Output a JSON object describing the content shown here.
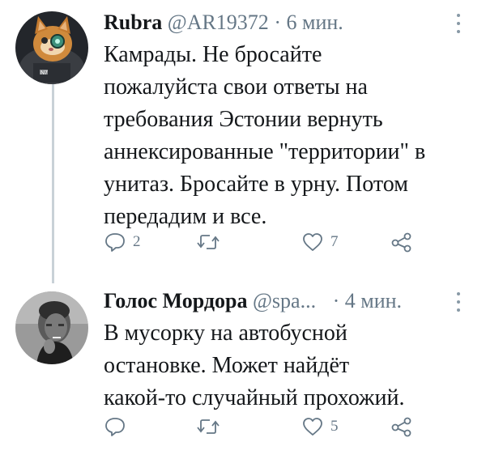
{
  "tweets": [
    {
      "author_name": "Rubra",
      "handle": "@AR19372",
      "separator": "·",
      "time": "6 мин.",
      "avatar": "cat-avatar",
      "avatar_text": "N7",
      "body_lines": [
        "Камрады. Не бросайте",
        "пожалуйста свои ответы на",
        "требования Эстонии вернуть",
        "аннексированные \"территории\" в",
        "унитаз. Бросайте в урну. Потом",
        "передадим и все."
      ],
      "reply_count": "2",
      "retweet_count": "",
      "like_count": "7"
    },
    {
      "author_name": "Голос Мордора",
      "handle": "@spa...",
      "separator": "·",
      "time": "4 мин.",
      "avatar": "man-avatar",
      "body_lines": [
        "В мусорку на автобусной",
        "остановке. Может найдёт",
        "какой-то случайный прохожий."
      ],
      "reply_count": "",
      "retweet_count": "",
      "like_count": "5"
    }
  ],
  "icons": {
    "reply": "reply-icon",
    "retweet": "retweet-icon",
    "like": "heart-icon",
    "share": "share-icon",
    "more": "more-vertical-icon"
  },
  "colors": {
    "text": "#14171a",
    "muted": "#657786",
    "thread_line": "#c9d1d7"
  }
}
